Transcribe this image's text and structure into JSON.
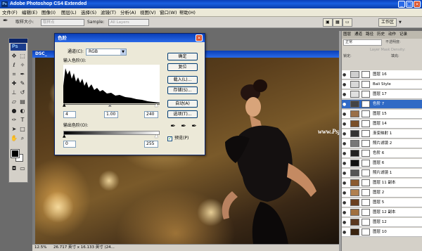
{
  "app": {
    "title": "Adobe Photoshop CS4 Extended",
    "ps_icon": "Ps"
  },
  "menu": [
    "文件(F)",
    "编辑(E)",
    "图像(I)",
    "图层(L)",
    "选择(S)",
    "滤镜(T)",
    "分析(A)",
    "视图(V)",
    "窗口(W)",
    "帮助(H)"
  ],
  "options": {
    "sample_size_label": "取样大小:",
    "sample_size_value": "取样点",
    "sample_label": "Sample:",
    "sample_value": "All Layers",
    "workspace_label": "工作区"
  },
  "toolbox": {
    "logo": "Ps"
  },
  "document": {
    "title": "DSC_",
    "zoom": "12.5%",
    "doc_info": "26.717 英寸 x 16.133 英寸 (24..."
  },
  "levels": {
    "title": "色阶",
    "channel_label": "通道(C):",
    "channel_value": "RGB",
    "input_label": "输入色阶(I):",
    "input_black": "4",
    "input_gamma": "1.00",
    "input_white": "240",
    "output_label": "输出色阶(O):",
    "output_black": "0",
    "output_white": "255",
    "buttons": {
      "ok": "确定",
      "reset": "复位",
      "load": "载入(L)...",
      "save": "存储(S)...",
      "auto": "自动(A)",
      "options": "选项(T)..."
    },
    "preview_label": "预览(P)"
  },
  "panels": {
    "tabs": [
      "图层",
      "通道",
      "路径",
      "历史",
      "动作",
      "记录"
    ],
    "blend_mode": "正常",
    "opacity_label": "不透明度:",
    "density_label": "Layer Mask Density:",
    "lock_label": "锁定:",
    "fill_label": "填充:",
    "layers": [
      {
        "name": "图层 16",
        "selected": false
      },
      {
        "name": "Bali Style",
        "selected": false
      },
      {
        "name": "图层 17",
        "selected": false
      },
      {
        "name": "色阶 7",
        "selected": true
      },
      {
        "name": "图层 15",
        "selected": false
      },
      {
        "name": "图层 14",
        "selected": false
      },
      {
        "name": "渐变映射 1",
        "selected": false
      },
      {
        "name": "照片滤镜 2",
        "selected": false
      },
      {
        "name": "色阶 6",
        "selected": false
      },
      {
        "name": "图层 6",
        "selected": false
      },
      {
        "name": "照片滤镜 1",
        "selected": false
      },
      {
        "name": "图层 11 副本",
        "selected": false
      },
      {
        "name": "图层 2",
        "selected": false
      },
      {
        "name": "图层 5",
        "selected": false
      },
      {
        "name": "图层 12 副本",
        "selected": false
      },
      {
        "name": "图层 12",
        "selected": false
      },
      {
        "name": "图层 10",
        "selected": false
      }
    ]
  },
  "watermark": "www.Psjia.com"
}
